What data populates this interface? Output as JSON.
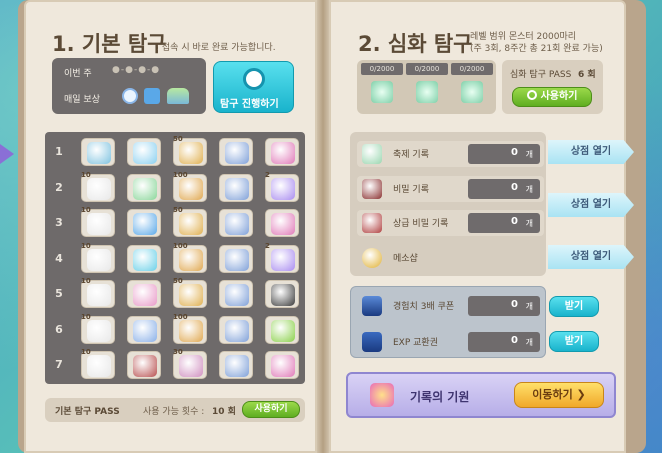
{
  "left": {
    "title": "1. 기본 탐구",
    "subtitle": ": 접속 시 바로 완료 가능합니다.",
    "this_week_label": "이번 주",
    "daily_reward_label": "매일 보상",
    "explore_button": "탐구 진행하기",
    "rows": [
      {
        "num": "1",
        "items": [
          {
            "icon": "clam-icon",
            "badge": "",
            "color": "#7fc3e0"
          },
          {
            "icon": "crystal-card-icon",
            "badge": "",
            "color": "#8ad0f0"
          },
          {
            "icon": "gold-coin-badge-icon",
            "badge": "50",
            "color": "#e0b050"
          },
          {
            "icon": "ticket-icon",
            "badge": "",
            "color": "#7fa0d8"
          },
          {
            "icon": "scroll-icon",
            "badge": "",
            "color": "#e07ab8"
          }
        ]
      },
      {
        "num": "2",
        "items": [
          {
            "icon": "flower-icon",
            "badge": "10",
            "color": "#e8e8e8"
          },
          {
            "icon": "green-card-icon",
            "badge": "",
            "color": "#8ad69a"
          },
          {
            "icon": "medal-icon",
            "badge": "100",
            "color": "#e0a850"
          },
          {
            "icon": "ticket-icon",
            "badge": "",
            "color": "#7fa0d8"
          },
          {
            "icon": "purple-gem-icon",
            "badge": "2",
            "color": "#a98cf0"
          }
        ]
      },
      {
        "num": "3",
        "items": [
          {
            "icon": "flower-icon",
            "badge": "10",
            "color": "#e8e8e8"
          },
          {
            "icon": "blue-bottle-icon",
            "badge": "",
            "color": "#5aa8e8"
          },
          {
            "icon": "gold-coin-badge-icon",
            "badge": "50",
            "color": "#e0b050"
          },
          {
            "icon": "ticket-icon",
            "badge": "",
            "color": "#7fa0d8"
          },
          {
            "icon": "scroll-icon",
            "badge": "",
            "color": "#e07ab8"
          }
        ]
      },
      {
        "num": "4",
        "items": [
          {
            "icon": "flower-icon",
            "badge": "10",
            "color": "#e8e8e8"
          },
          {
            "icon": "blue-swirl-icon",
            "badge": "",
            "color": "#6ad0e8"
          },
          {
            "icon": "medal-icon",
            "badge": "100",
            "color": "#e0a850"
          },
          {
            "icon": "ticket-icon",
            "badge": "",
            "color": "#7fa0d8"
          },
          {
            "icon": "purple-gem-icon",
            "badge": "2",
            "color": "#a98cf0"
          }
        ]
      },
      {
        "num": "5",
        "items": [
          {
            "icon": "flower-icon",
            "badge": "10",
            "color": "#e8e8e8"
          },
          {
            "icon": "pink-card-icon",
            "badge": "",
            "color": "#e89ac8"
          },
          {
            "icon": "gold-coin-badge-icon",
            "badge": "50",
            "color": "#e0b050"
          },
          {
            "icon": "ticket-icon",
            "badge": "",
            "color": "#7fa0d8"
          },
          {
            "icon": "black-bomb-icon",
            "badge": "",
            "color": "#3a3a3a"
          }
        ]
      },
      {
        "num": "6",
        "items": [
          {
            "icon": "flower-icon",
            "badge": "10",
            "color": "#e8e8e8"
          },
          {
            "icon": "ticket-card-icon",
            "badge": "",
            "color": "#8ab0e8"
          },
          {
            "icon": "medal-icon",
            "badge": "100",
            "color": "#e0a850"
          },
          {
            "icon": "ticket-icon",
            "badge": "",
            "color": "#7fa0d8"
          },
          {
            "icon": "green-apple-icon",
            "badge": "",
            "color": "#8ad04a"
          }
        ]
      },
      {
        "num": "7",
        "items": [
          {
            "icon": "flower-icon",
            "badge": "10",
            "color": "#e8e8e8"
          },
          {
            "icon": "red-book-icon",
            "badge": "",
            "color": "#b85050"
          },
          {
            "icon": "treasure-chest-icon",
            "badge": "30",
            "color": "#d090c0"
          },
          {
            "icon": "ticket-icon",
            "badge": "",
            "color": "#7fa0d8"
          },
          {
            "icon": "scroll-icon",
            "badge": "",
            "color": "#e07ab8"
          }
        ]
      }
    ],
    "pass_label": "기본 탐구 PASS",
    "available_label": "사용 가능 횟수 :",
    "available_count": "10 회",
    "use_button": "사용하기"
  },
  "right": {
    "title": "2. 심화 탐구",
    "desc_line1": "레벨 범위 몬스터 2000마리",
    "desc_line2": "(주 3회, 8주간 총 21회 완료 가능)",
    "progress": [
      "0/2000",
      "0/2000",
      "0/2000"
    ],
    "pass_label": "심화 탐구 PASS",
    "pass_count": "6 회",
    "use_button": "사용하기",
    "records": [
      {
        "label": "축제 기록",
        "value": "0",
        "unit": "개",
        "icon": "festival-record-icon",
        "color": "#9ad6b0"
      },
      {
        "label": "비밀 기록",
        "value": "0",
        "unit": "개",
        "icon": "secret-record-icon",
        "color": "#8a3030"
      },
      {
        "label": "상급 비밀 기록",
        "value": "0",
        "unit": "개",
        "icon": "advanced-secret-record-icon",
        "color": "#b04040"
      },
      {
        "label": "메소샵",
        "value": "",
        "unit": "",
        "icon": "meso-coin-icon",
        "color": "#e0b030"
      }
    ],
    "shop_button": "상점 열기",
    "coupons": [
      {
        "label": "경험치 3배 쿠폰",
        "value": "0",
        "unit": "개",
        "icon": "exp-coupon-icon",
        "color": "#5a8ad8"
      },
      {
        "label": "EXP 교환권",
        "value": "0",
        "unit": "개",
        "icon": "exp-ticket-icon",
        "color": "#3a6ac0"
      }
    ],
    "receive_button": "받기",
    "origin_label": "기록의 기원",
    "move_button": "이동하기 ❯"
  }
}
